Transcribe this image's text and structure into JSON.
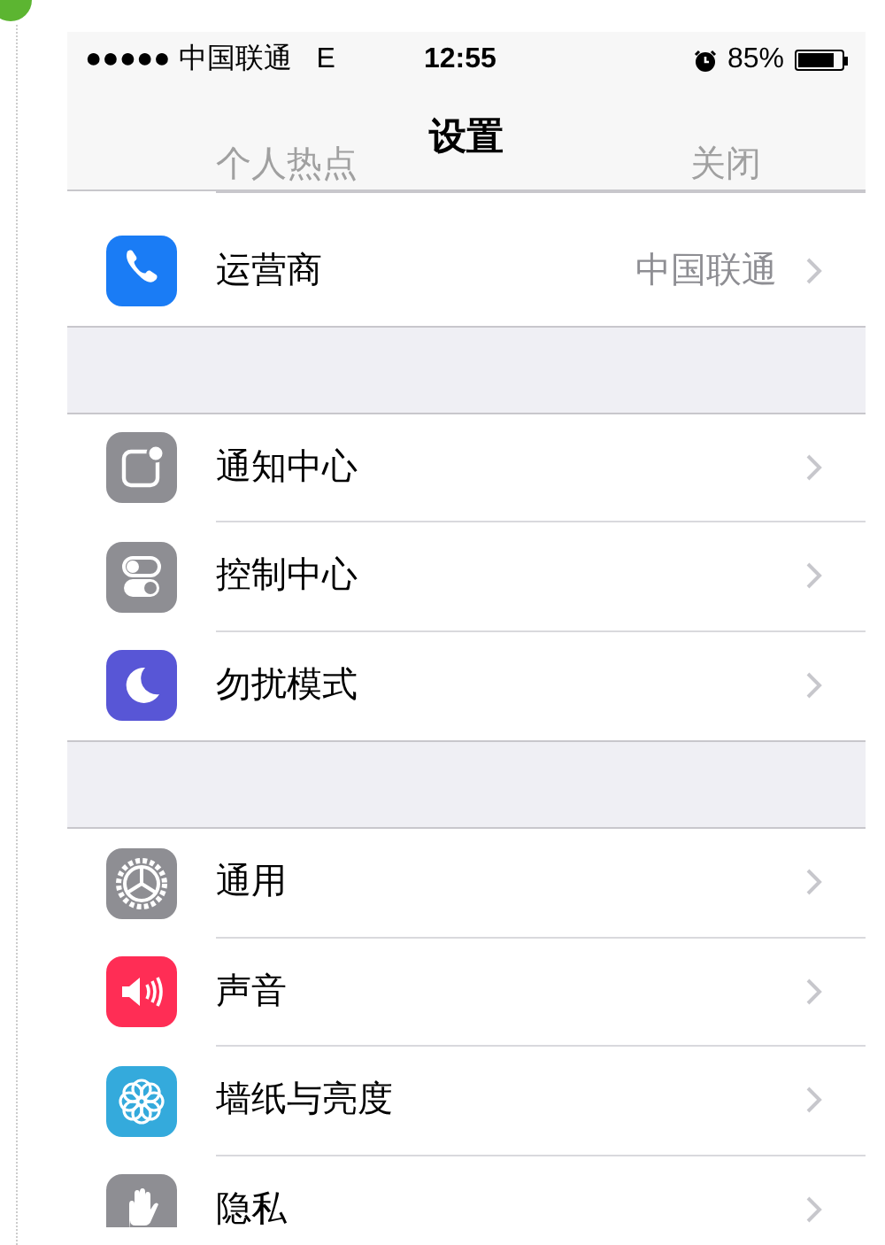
{
  "status_bar": {
    "carrier": "●●●●● 中国联通",
    "network": "E",
    "time": "12:55",
    "battery": "85%"
  },
  "nav_bar": {
    "title": "设置"
  },
  "under_nav_row": {
    "label": "个人热点",
    "value": "关闭"
  },
  "groups": [
    {
      "rows": [
        {
          "kind": "phone",
          "label": "运营商",
          "value": "中国联通"
        }
      ]
    },
    {
      "rows": [
        {
          "kind": "notifications",
          "label": "通知中心"
        },
        {
          "kind": "toggles",
          "label": "控制中心"
        },
        {
          "kind": "moon",
          "label": "勿扰模式"
        }
      ]
    },
    {
      "rows": [
        {
          "kind": "gear",
          "label": "通用"
        },
        {
          "kind": "speaker",
          "label": "声音"
        },
        {
          "kind": "flower",
          "label": "墙纸与亮度"
        },
        {
          "kind": "hand",
          "label": "隐私"
        }
      ]
    }
  ]
}
